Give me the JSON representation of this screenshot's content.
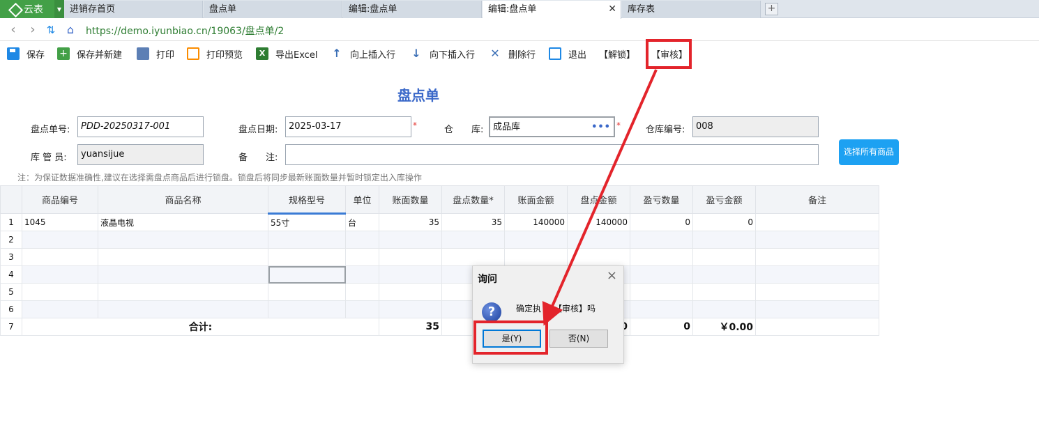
{
  "app": {
    "brand": "云表"
  },
  "tabs": [
    {
      "label": "进销存首页"
    },
    {
      "label": "盘点单"
    },
    {
      "label": "编辑:盘点单"
    },
    {
      "label": "编辑:盘点单",
      "active": true
    },
    {
      "label": "库存表"
    }
  ],
  "address": {
    "url": "https://demo.iyunbiao.cn/19063/盘点单/2"
  },
  "toolbar": {
    "save": "保存",
    "save_new": "保存并新建",
    "print": "打印",
    "print_preview": "打印预览",
    "export_excel": "导出Excel",
    "insert_above": "向上插入行",
    "insert_below": "向下插入行",
    "delete_row": "删除行",
    "exit": "退出",
    "unlock": "【解锁】",
    "audit": "【审核】"
  },
  "form": {
    "title": "盘点单",
    "no_label": "盘点单号:",
    "no_value": "PDD-20250317-001",
    "date_label": "盘点日期:",
    "date_value": "2025-03-17",
    "warehouse_label": "仓　　库:",
    "warehouse_value": "成品库",
    "warehouse_code_label": "仓库编号:",
    "warehouse_code_value": "008",
    "keeper_label": "库 管 员:",
    "keeper_value": "yuansijue",
    "remark_label": "备　　注:",
    "remark_value": "",
    "required_mark": "*",
    "more_dots": "•••",
    "select_all_button": "选择所有商品",
    "note": "注：为保证数据准确性,建议在选择需盘点商品后进行锁盘。锁盘后将同步最新账面数量并暂时锁定出入库操作"
  },
  "grid": {
    "columns": [
      "商品编号",
      "商品名称",
      "规格型号",
      "单位",
      "账面数量",
      "盘点数量*",
      "账面金额",
      "盘点金额",
      "盈亏数量",
      "盈亏金额",
      "备注"
    ],
    "rows": [
      [
        "1",
        "1045",
        "液晶电视",
        "55寸",
        "台",
        "35",
        "35",
        "140000",
        "140000",
        "0",
        "0",
        ""
      ],
      [
        "2",
        "",
        "",
        "",
        "",
        "",
        "",
        "",
        "",
        "",
        "",
        ""
      ],
      [
        "3",
        "",
        "",
        "",
        "",
        "",
        "",
        "",
        "",
        "",
        "",
        ""
      ],
      [
        "4",
        "",
        "",
        "",
        "",
        "",
        "",
        "",
        "",
        "",
        "",
        ""
      ],
      [
        "5",
        "",
        "",
        "",
        "",
        "",
        "",
        "",
        "",
        "",
        "",
        ""
      ],
      [
        "6",
        "",
        "",
        "",
        "",
        "",
        "",
        "",
        "",
        "",
        "",
        ""
      ]
    ],
    "summary": {
      "row_no": "7",
      "label": "合计:",
      "book_qty": "35",
      "profit_loss_qty_partial": "0",
      "profit_loss_qty": "0",
      "profit_loss_amount": "￥0.00"
    }
  },
  "dialog": {
    "title": "询问",
    "message_left": "确定执",
    "message_right": "【审核】吗",
    "yes": "是(Y)",
    "no": "否(N)"
  },
  "colors": {
    "annotation": "#e3242b",
    "brand": "#43a047",
    "title": "#3a68c9"
  }
}
